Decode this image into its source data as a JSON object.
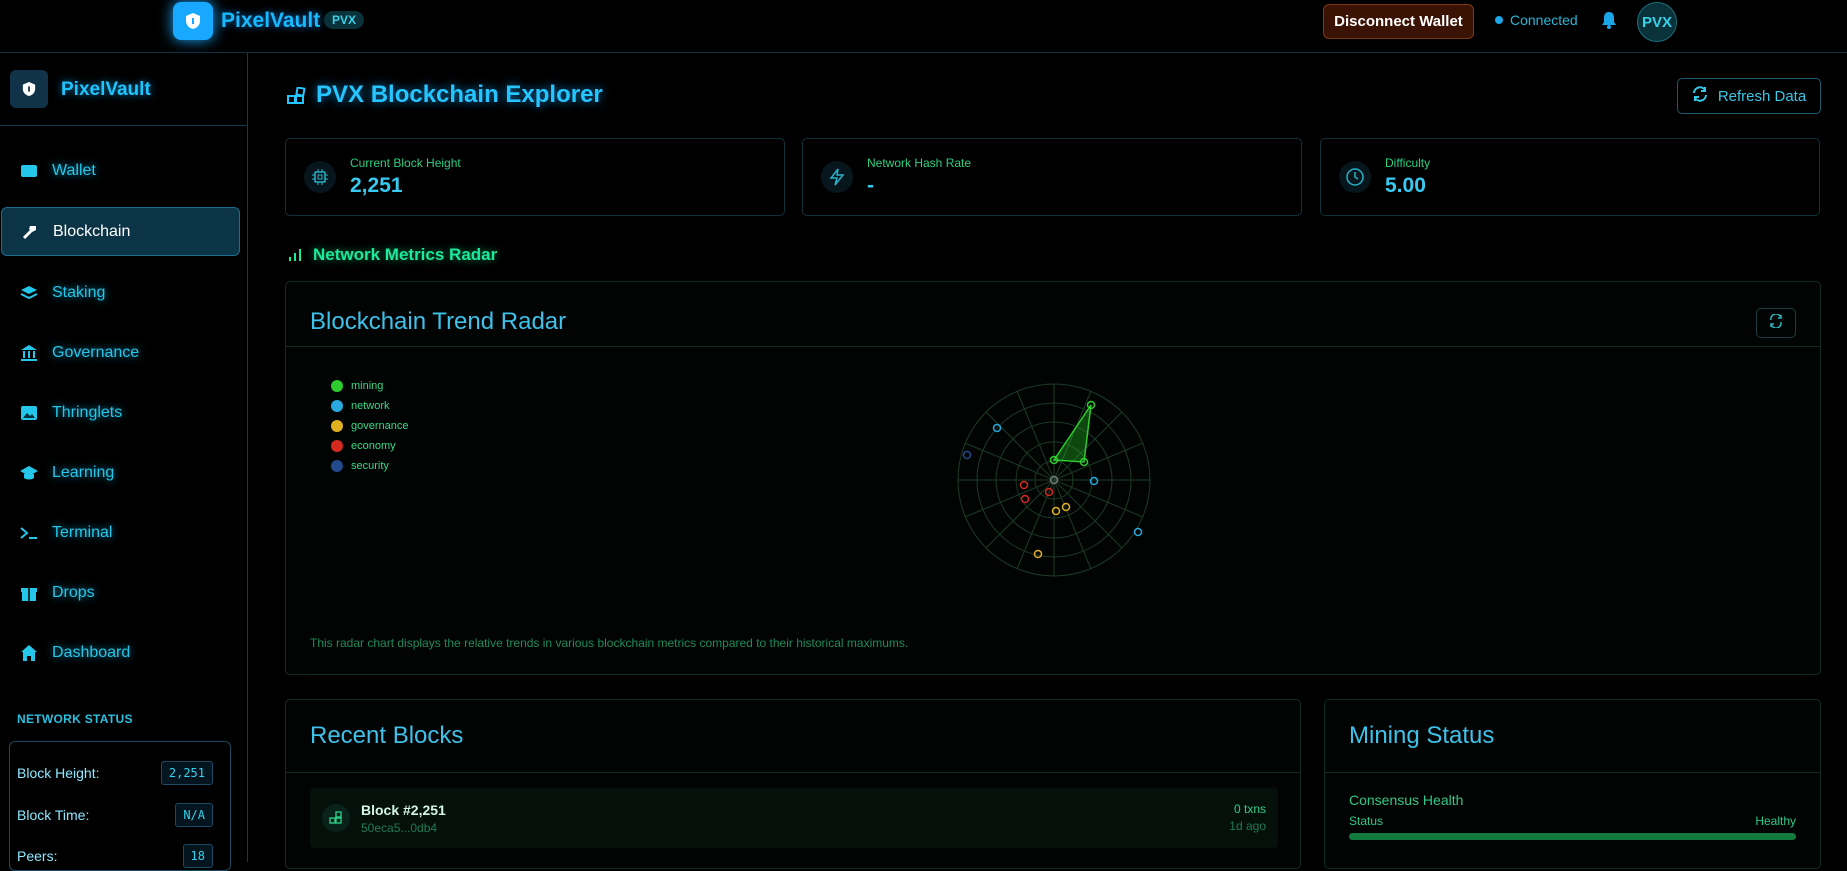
{
  "topbar": {
    "brand": "PixelVault",
    "badge": "PVX",
    "disconnect_label": "Disconnect  Wallet",
    "status": "Connected",
    "avatar": "PVX"
  },
  "sidebar": {
    "brand": "PixelVault",
    "items": [
      {
        "label": "Wallet",
        "icon": "wallet-icon"
      },
      {
        "label": "Blockchain",
        "icon": "hammer-icon",
        "active": true
      },
      {
        "label": "Staking",
        "icon": "layers-icon"
      },
      {
        "label": "Governance",
        "icon": "bank-icon"
      },
      {
        "label": "Thringlets",
        "icon": "image-icon"
      },
      {
        "label": "Learning",
        "icon": "graduation-cap-icon"
      },
      {
        "label": "Terminal",
        "icon": "terminal-icon"
      },
      {
        "label": "Drops",
        "icon": "gift-icon"
      },
      {
        "label": "Dashboard",
        "icon": "home-icon"
      }
    ],
    "network_status": {
      "title": "NETWORK STATUS",
      "rows": [
        {
          "label": "Block Height:",
          "value": "2,251"
        },
        {
          "label": "Block Time:",
          "value": "N/A"
        },
        {
          "label": "Peers:",
          "value": "18"
        }
      ]
    }
  },
  "main": {
    "title": "PVX Blockchain Explorer",
    "refresh_label": "Refresh Data",
    "stats": [
      {
        "label": "Current Block Height",
        "value": "2,251",
        "icon": "cpu-icon"
      },
      {
        "label": "Network Hash Rate",
        "value": "-",
        "icon": "lightning-icon"
      },
      {
        "label": "Difficulty",
        "value": "5.00",
        "icon": "clock-icon"
      }
    ],
    "section_title": "Network Metrics Radar",
    "radar": {
      "title": "Blockchain Trend Radar",
      "note": "This radar chart displays the relative trends in various blockchain metrics compared to their historical maximums.",
      "legend": [
        {
          "name": "mining",
          "color": "#2fcc2f"
        },
        {
          "name": "network",
          "color": "#29a9e0"
        },
        {
          "name": "governance",
          "color": "#e0b020"
        },
        {
          "name": "economy",
          "color": "#d42a1f"
        },
        {
          "name": "security",
          "color": "#224a8c"
        }
      ]
    },
    "recent_blocks": {
      "title": "Recent Blocks",
      "items": [
        {
          "name": "Block #2,251",
          "hash": "50eca5...0db4",
          "txns": "0 txns",
          "ago": "1d ago"
        }
      ]
    },
    "mining": {
      "title": "Mining Status",
      "subtitle": "Consensus Health",
      "status_label": "Status",
      "status_value": "Healthy",
      "health": 1.0
    }
  }
}
